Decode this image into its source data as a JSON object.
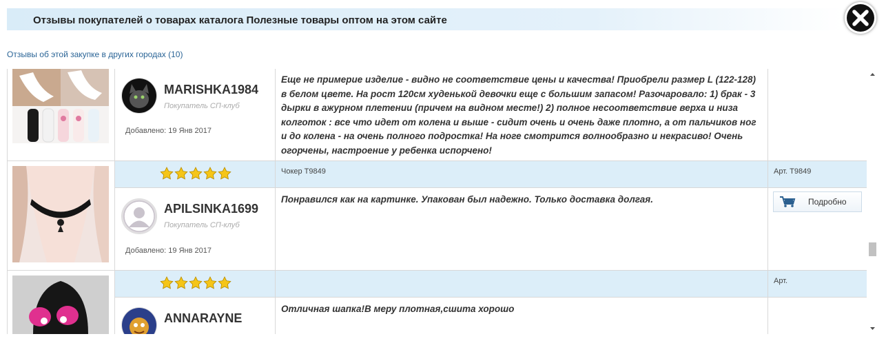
{
  "header": {
    "title": "Отзывы покупателей о товарах каталога Полезные товары оптом на этом сайте"
  },
  "close_icon": "close-icon",
  "other_cities_link": "Отзывы об этой закупке в других городах (10)",
  "reviews": [
    {
      "username": "MARISHKA1984",
      "role": "Покупатель СП-клуб",
      "date": "Добавлено: 19 Янв 2017",
      "text": "Еще не примерие изделие - видно не соответствие цены и качества! Приобрели размер L (122-128) в белом цвете. На рост 120см худенькой девочки еще с большим запасом! Разочаровало: 1) брак - 3 дырки в ажурном плетении (причем на видном месте!) 2) полное несоответствие верха и низа колготок : все что идет от колена и выше - сидит очень и очень даже плотно, а от пальчиков ног и до колена - на очень полного подростка! На ноге смотрится волнообразно и некрасиво! Очень огорчены, настроение у ребенка испорчено!",
      "avatar": "black-cat-avatar"
    },
    {
      "product": "Чокер T9849",
      "article": "Арт. T9849",
      "rating": 5,
      "username": "APILSINKA1699",
      "role": "Покупатель СП-клуб",
      "date": "Добавлено: 19 Янв 2017",
      "text": "Понравился как на картинке. Упакован был надежно. Только доставка долгая.",
      "detail_button": "Подробно",
      "avatar": "default-user-avatar"
    },
    {
      "product": "",
      "article": "Арт.",
      "rating": 5,
      "username": "ANNARAYNE",
      "text": "Отличная шапка!В меру плотная,сшита хорошо",
      "avatar": "cartoon-avatar"
    }
  ],
  "colors": {
    "band": "#dceef9",
    "header": "#d9ecf8",
    "link": "#2a6496",
    "star": "#f5c518"
  }
}
